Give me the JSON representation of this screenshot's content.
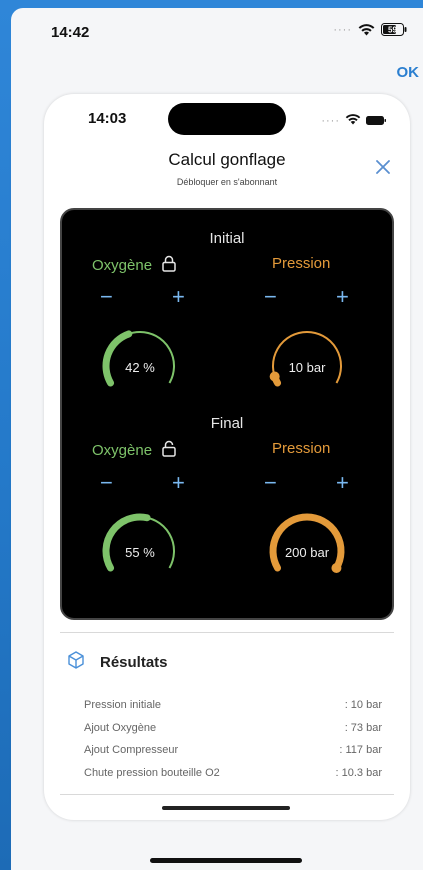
{
  "outer_status": {
    "time": "14:42",
    "battery": "59"
  },
  "nav": {
    "ok_label": "OK"
  },
  "inner_status": {
    "time": "14:03"
  },
  "header": {
    "title": "Calcul gonflage",
    "subtitle": "Débloquer en s'abonnant"
  },
  "initial": {
    "section_label": "Initial",
    "oxygen_label": "Oxygène",
    "pressure_label": "Pression",
    "minus": "−",
    "plus": "+",
    "oxygen_value": "42 %",
    "oxygen_fraction": 0.42,
    "pressure_value": "10 bar",
    "pressure_fraction": 0.05
  },
  "final": {
    "section_label": "Final",
    "oxygen_label": "Oxygène",
    "pressure_label": "Pression",
    "minus": "−",
    "plus": "+",
    "oxygen_value": "55 %",
    "oxygen_fraction": 0.55,
    "pressure_value": "200 bar",
    "pressure_fraction": 1.0
  },
  "results": {
    "title": "Résultats",
    "rows": [
      {
        "label": "Pression initiale",
        "value": ": 10 bar"
      },
      {
        "label": "Ajout Oxygène",
        "value": ": 73 bar"
      },
      {
        "label": "Ajout Compresseur",
        "value": ": 117 bar"
      },
      {
        "label": "Chute pression bouteille O2",
        "value": ": 10.3 bar"
      }
    ]
  },
  "colors": {
    "oxygen": "#7ec36a",
    "pressure": "#e39a3a",
    "stepper": "#7ab8f0",
    "accent": "#2b7fd0"
  },
  "icons": {
    "lock": "lock-icon",
    "close": "close-icon",
    "results": "cube-icon",
    "wifi": "wifi-icon",
    "battery": "battery-icon"
  }
}
